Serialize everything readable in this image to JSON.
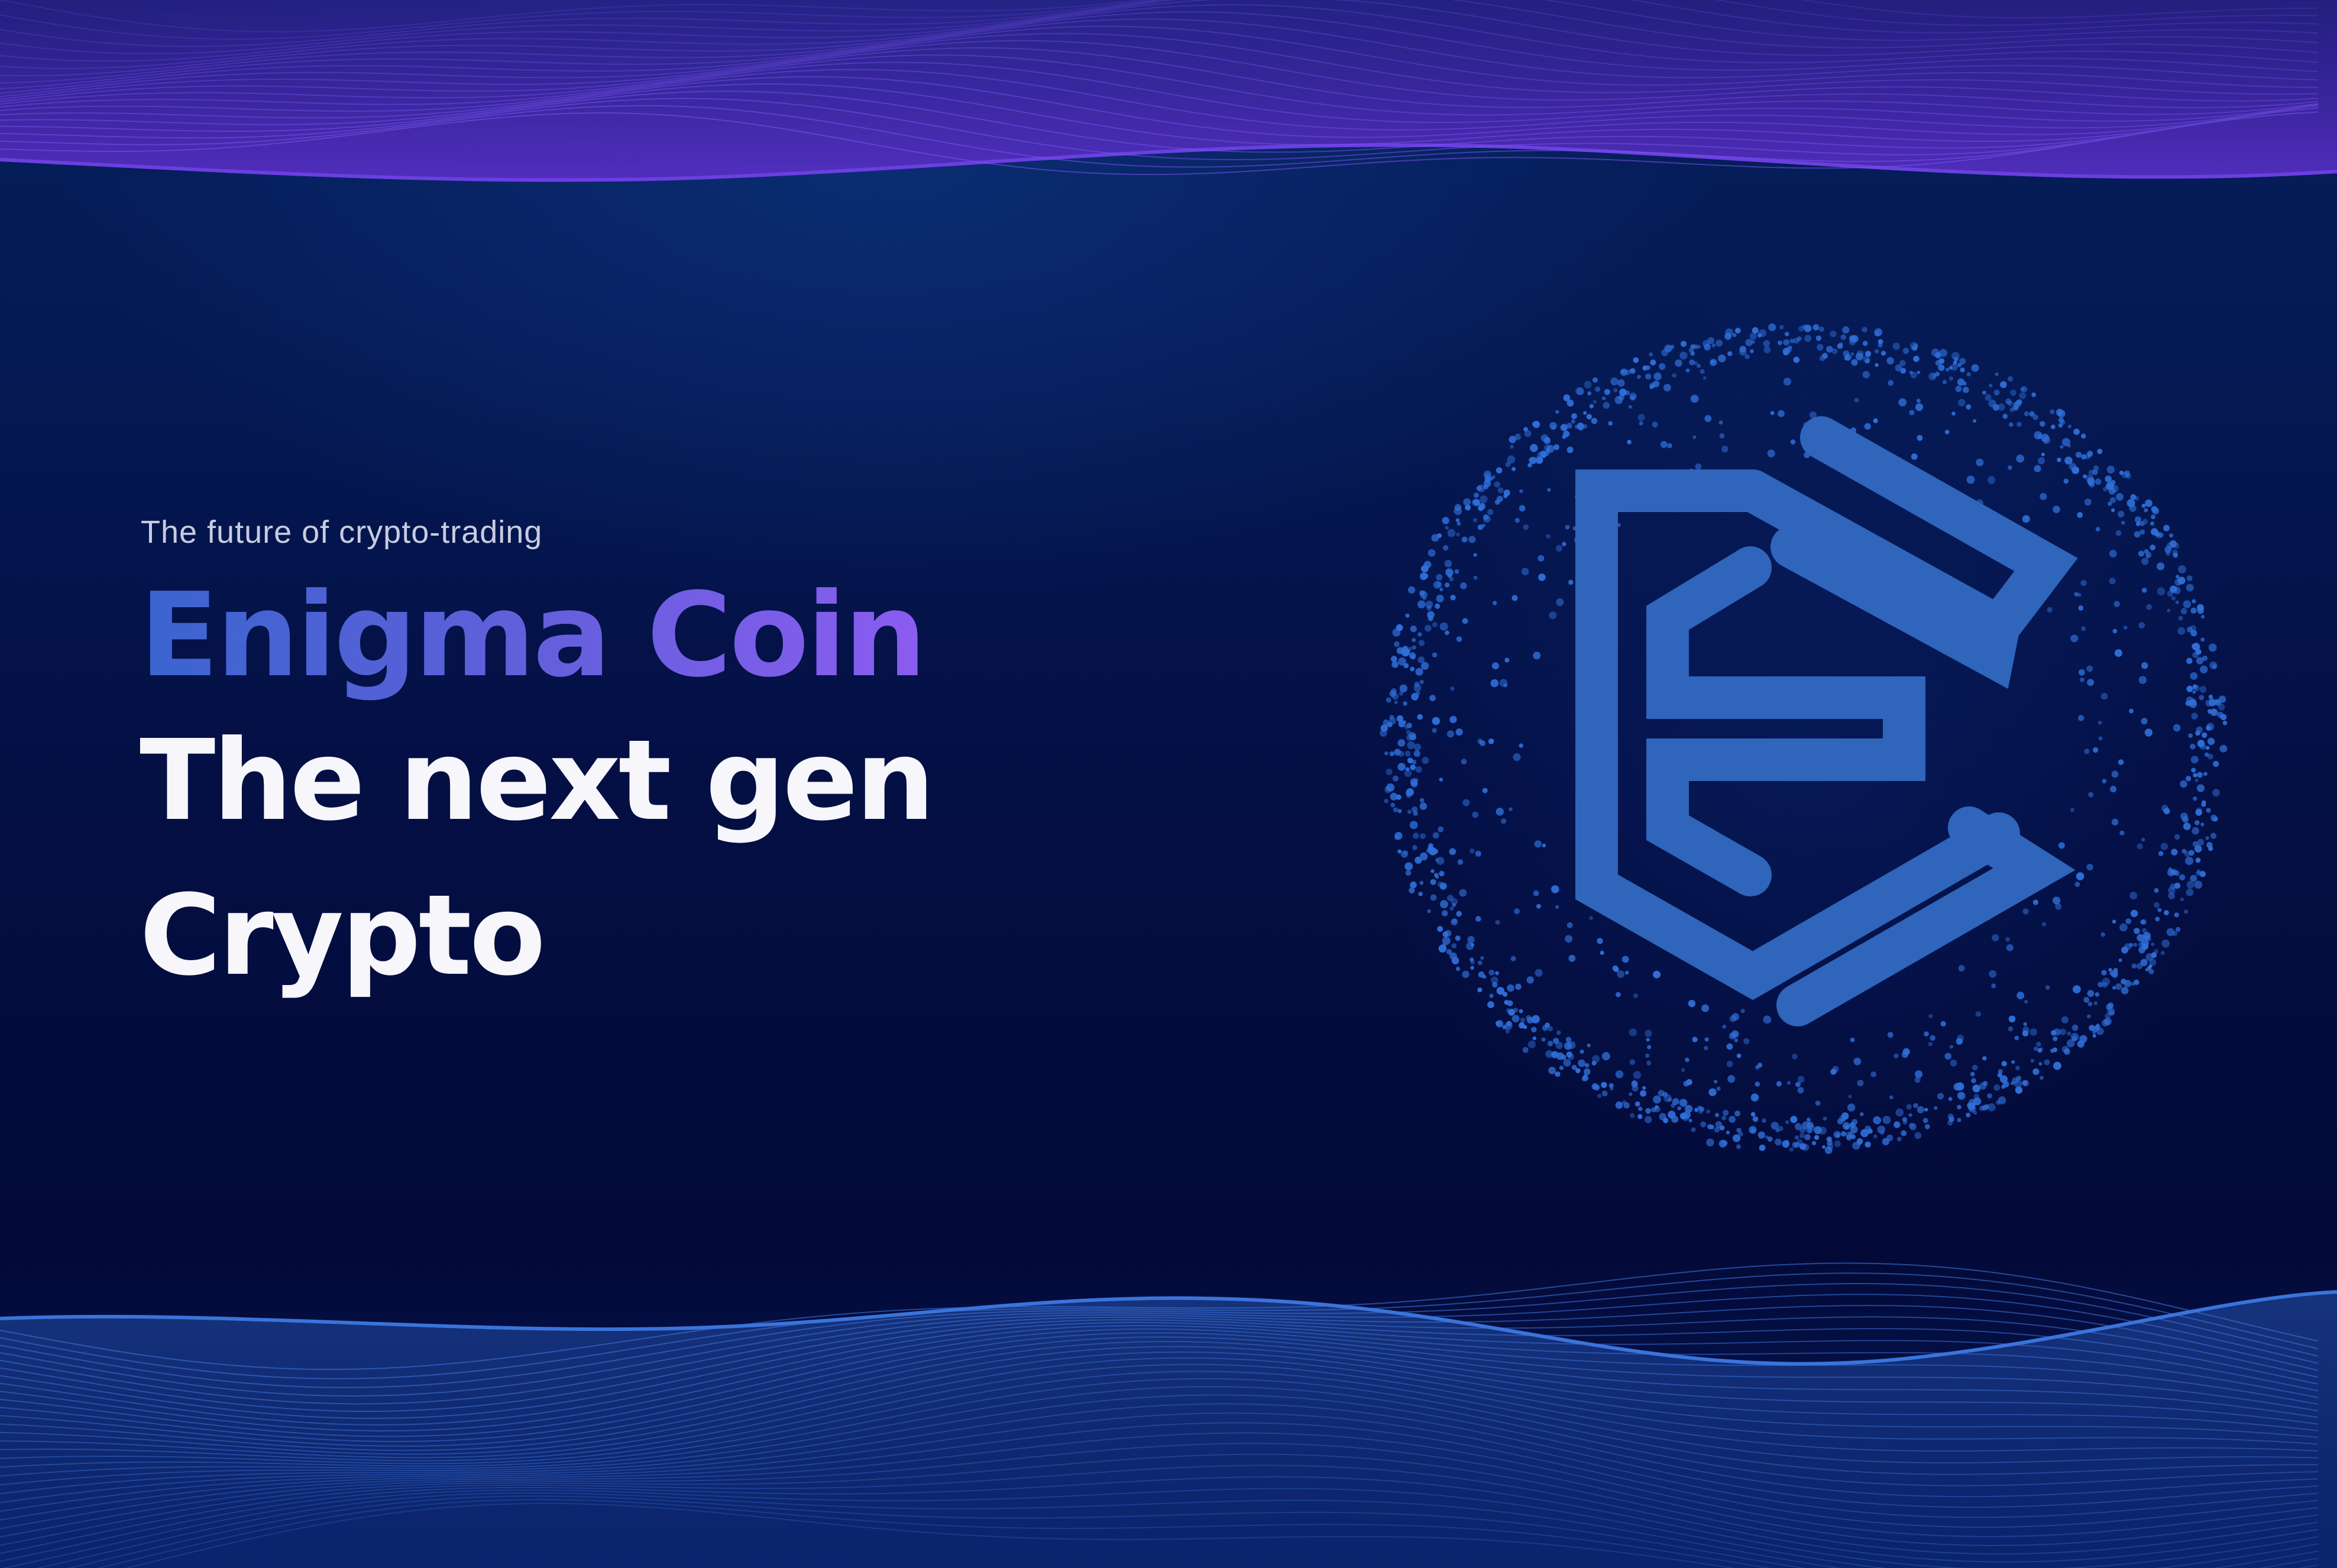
{
  "tagline": "The future of crypto-trading",
  "brand_name": "Enigma Coin",
  "headline_line1": "The next gen",
  "headline_line2": "Crypto",
  "logo_icon": "enigma-coin-logo-icon",
  "colors": {
    "background": "#030b3a",
    "purple_wave": "#6a3dd6",
    "blue_wave": "#2f63c0",
    "logo_blue": "#2f65bb",
    "brand_gradient_start": "#3a65cf",
    "brand_gradient_end": "#8b5cf0",
    "headline": "#f6f6fb"
  }
}
